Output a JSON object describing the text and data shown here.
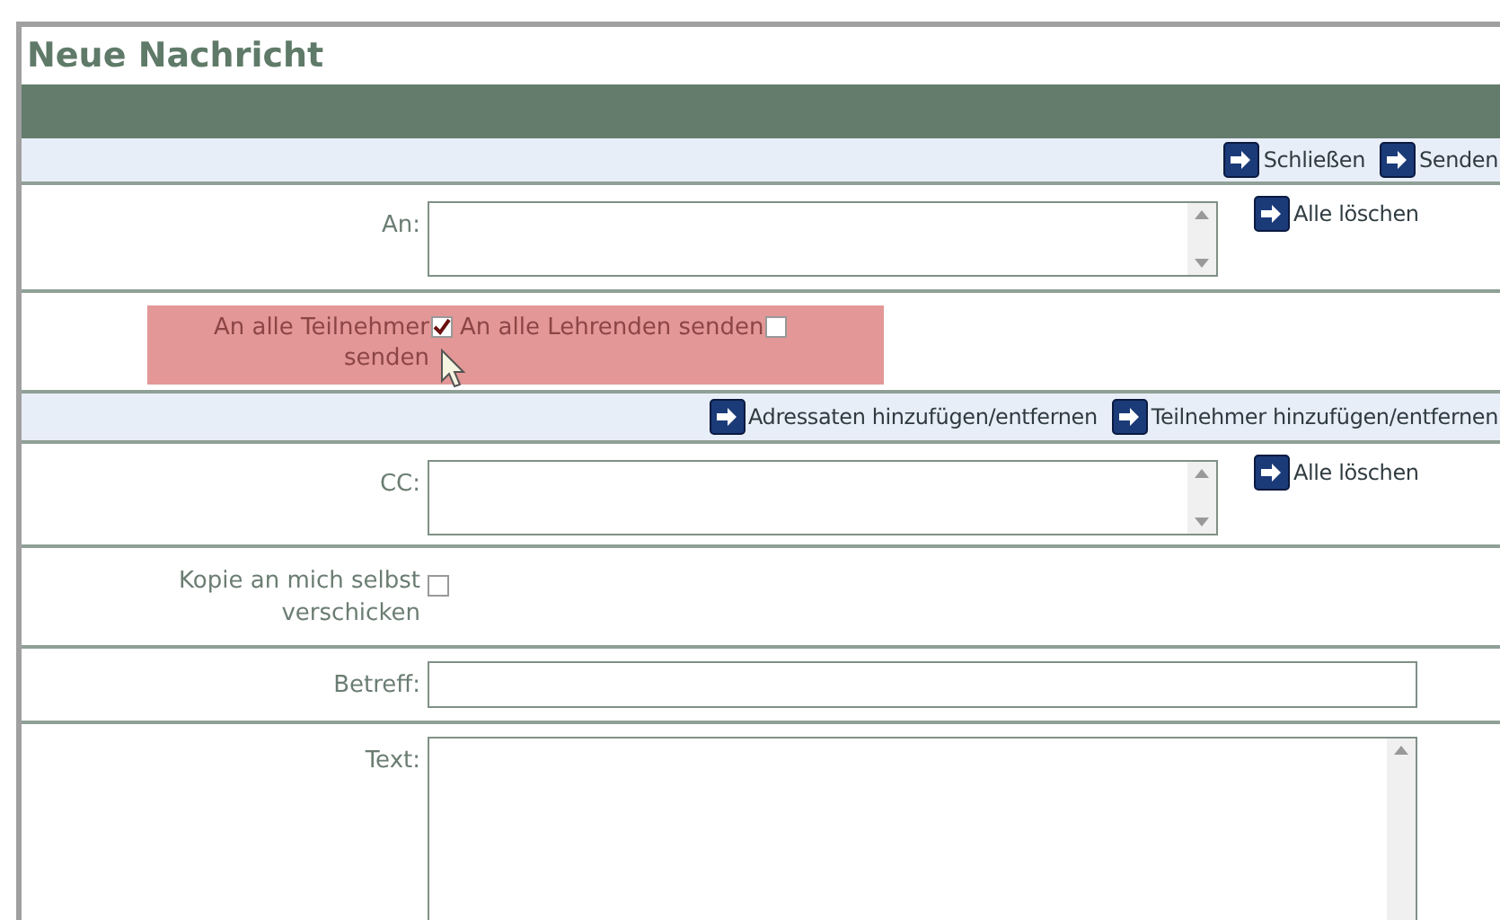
{
  "title": "Neue Nachricht",
  "top_actions": [
    "Schließen",
    "Senden"
  ],
  "to": {
    "label": "An:",
    "clear": "Alle löschen"
  },
  "send_all": [
    {
      "label": "An alle Teilnehmer senden",
      "checked": true
    },
    {
      "label": "An alle Lehrenden senden",
      "checked": false
    }
  ],
  "recipient_actions": [
    "Adressaten hinzufügen/entfernen",
    "Teilnehmer hinzufügen/entfernen"
  ],
  "cc": {
    "label": "CC:",
    "clear": "Alle löschen"
  },
  "copy_self": {
    "label": "Kopie an mich selbst verschicken",
    "checked": false
  },
  "subject": {
    "label": "Betreff:"
  },
  "text": {
    "label": "Text:"
  }
}
